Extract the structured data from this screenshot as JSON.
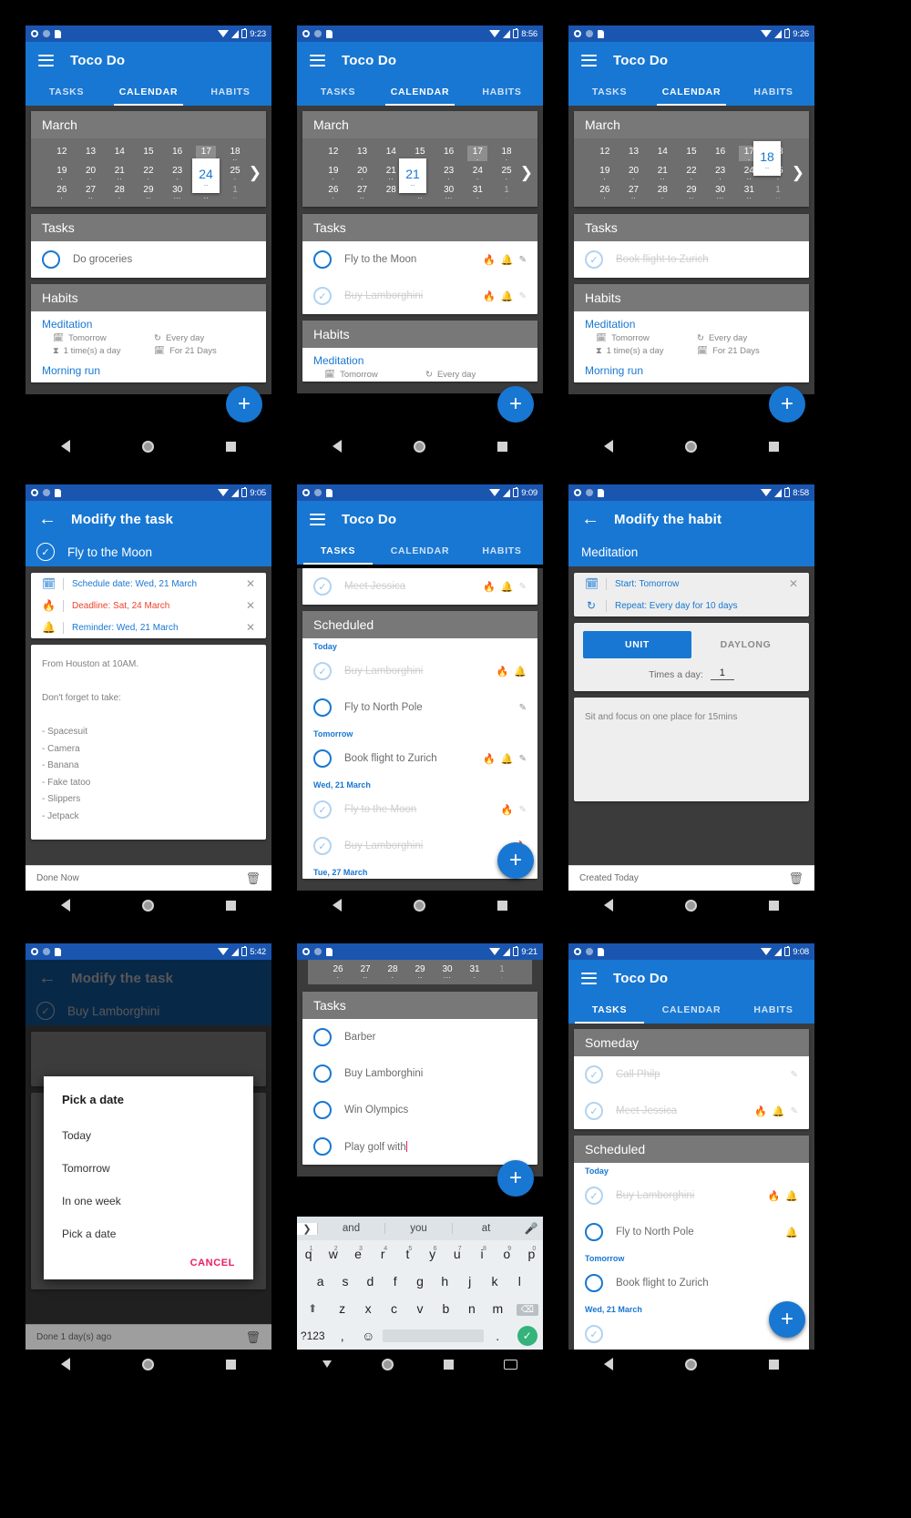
{
  "app": {
    "name": "Toco Do"
  },
  "tabs": {
    "tasks": "TASKS",
    "calendar": "CALENDAR",
    "habits": "HABITS"
  },
  "sections": {
    "tasks": "Tasks",
    "habits": "Habits",
    "scheduled": "Scheduled",
    "someday": "Someday"
  },
  "screens": [
    {
      "id": "calendar-24",
      "time": "9:23",
      "title": "Toco Do",
      "active_tab": "CALENDAR",
      "month": "March",
      "calendar": {
        "rows": [
          [
            {
              "d": "12"
            },
            {
              "d": "13"
            },
            {
              "d": "14"
            },
            {
              "d": "15"
            },
            {
              "d": "16"
            },
            {
              "d": "17",
              "today": true
            },
            {
              "d": "18",
              "dots": ".."
            }
          ],
          [
            {
              "d": "19",
              "dots": "."
            },
            {
              "d": "20",
              "dots": "."
            },
            {
              "d": "21",
              "dots": ".."
            },
            {
              "d": "22",
              "dots": "."
            },
            {
              "d": "23",
              "dots": "."
            },
            {
              "d": "24",
              "dots": ".."
            },
            {
              "d": "25",
              "dots": "."
            }
          ],
          [
            {
              "d": "26",
              "dots": "."
            },
            {
              "d": "27",
              "dots": ".."
            },
            {
              "d": "28",
              "dots": "."
            },
            {
              "d": "29",
              "dots": ".."
            },
            {
              "d": "30",
              "dots": "..."
            },
            {
              "d": "31",
              "dots": ".."
            },
            {
              "d": "1",
              "dots": "..",
              "muted": true
            }
          ]
        ],
        "selected": {
          "day": "24",
          "dots": ".."
        }
      },
      "tasks": [
        {
          "label": "Do groceries",
          "done": false,
          "icons": []
        }
      ],
      "habit": {
        "name": "Meditation",
        "when": "Tomorrow",
        "repeat": "Every day",
        "times": "1 time(s) a day",
        "duration": "For 21 Days",
        "next": "Morning run"
      }
    },
    {
      "id": "calendar-21",
      "time": "8:56",
      "title": "Toco Do",
      "active_tab": "CALENDAR",
      "month": "March",
      "calendar": {
        "rows": [
          [
            {
              "d": "12"
            },
            {
              "d": "13"
            },
            {
              "d": "14"
            },
            {
              "d": "15"
            },
            {
              "d": "16"
            },
            {
              "d": "17",
              "today": true,
              "dots": "."
            },
            {
              "d": "18",
              "dots": "."
            }
          ],
          [
            {
              "d": "19",
              "dots": "."
            },
            {
              "d": "20",
              "dots": "."
            },
            {
              "d": "21",
              "dots": ".."
            },
            {
              "d": "22",
              "dots": "."
            },
            {
              "d": "23",
              "dots": "."
            },
            {
              "d": "24",
              "dots": "."
            },
            {
              "d": "25",
              "dots": "."
            }
          ],
          [
            {
              "d": "26",
              "dots": "."
            },
            {
              "d": "27",
              "dots": ".."
            },
            {
              "d": "28",
              "dots": ""
            },
            {
              "d": "29",
              "dots": ".."
            },
            {
              "d": "30",
              "dots": "..."
            },
            {
              "d": "31",
              "dots": "."
            },
            {
              "d": "1",
              "dots": ".",
              "muted": true
            }
          ]
        ],
        "selected": {
          "day": "21",
          "dots": ".."
        }
      },
      "tasks": [
        {
          "label": "Fly to the Moon",
          "done": false,
          "icons": [
            "fire",
            "bell",
            "pen"
          ]
        },
        {
          "label": "Buy Lamborghini",
          "done": true,
          "icons": [
            "fire",
            "bell",
            "pen"
          ]
        }
      ],
      "habit": {
        "name": "Meditation",
        "when": "Tomorrow",
        "repeat": "Every day"
      }
    },
    {
      "id": "calendar-18",
      "time": "9:26",
      "title": "Toco Do",
      "active_tab": "CALENDAR",
      "month": "March",
      "calendar": {
        "rows": [
          [
            {
              "d": "12"
            },
            {
              "d": "13"
            },
            {
              "d": "14"
            },
            {
              "d": "15"
            },
            {
              "d": "16"
            },
            {
              "d": "17",
              "today": true,
              "dots": "."
            },
            {
              "d": "18"
            }
          ],
          [
            {
              "d": "19",
              "dots": "."
            },
            {
              "d": "20",
              "dots": "."
            },
            {
              "d": "21",
              "dots": ".."
            },
            {
              "d": "22",
              "dots": "."
            },
            {
              "d": "23",
              "dots": "."
            },
            {
              "d": "24",
              "dots": ".."
            },
            {
              "d": "25",
              "dots": "."
            }
          ],
          [
            {
              "d": "26",
              "dots": "."
            },
            {
              "d": "27",
              "dots": ".."
            },
            {
              "d": "28",
              "dots": "."
            },
            {
              "d": "29",
              "dots": ".."
            },
            {
              "d": "30",
              "dots": "..."
            },
            {
              "d": "31",
              "dots": ".."
            },
            {
              "d": "1",
              "dots": "..",
              "muted": true
            }
          ]
        ],
        "selected": {
          "day": "18",
          "dots": ".."
        }
      },
      "tasks": [
        {
          "label": "Book flight to Zurich",
          "done": true,
          "icons": []
        }
      ],
      "habit": {
        "name": "Meditation",
        "when": "Tomorrow",
        "repeat": "Every day",
        "times": "1 time(s) a day",
        "duration": "For 21 Days",
        "next": "Morning run"
      }
    },
    {
      "id": "modify-task-moon",
      "time": "9:05",
      "title": "Modify the task",
      "task_name": "Fly to the Moon",
      "meta": [
        {
          "icon": "calendar-icon",
          "text": "Schedule date: Wed, 21 March",
          "color": "blue"
        },
        {
          "icon": "fire-icon",
          "text": "Deadline: Sat, 24 March",
          "color": "red"
        },
        {
          "icon": "bell-icon",
          "text": "Reminder: Wed, 21 March",
          "color": "blue"
        }
      ],
      "notes": "From Houston at 10AM.\n\nDon't forget to take:\n\n- Spacesuit\n- Camera\n- Banana\n- Fake tatoo\n- Slippers\n- Jetpack",
      "footer": "Done Now"
    },
    {
      "id": "tasks-scheduled",
      "time": "9:09",
      "title": "Toco Do",
      "active_tab": "TASKS",
      "top_task": {
        "label": "Meet Jessica",
        "done": true,
        "icons": [
          "fire",
          "bell",
          "pen"
        ]
      },
      "groups": [
        {
          "header": "Today",
          "items": [
            {
              "label": "Buy Lamborghini",
              "done": true,
              "icons": [
                "fire",
                "bell"
              ]
            },
            {
              "label": "Fly to North Pole",
              "done": false,
              "icons": [
                "pen"
              ]
            }
          ]
        },
        {
          "header": "Tomorrow",
          "items": [
            {
              "label": "Book flight to Zurich",
              "done": false,
              "icons": [
                "fire",
                "bell",
                "pen"
              ]
            }
          ]
        },
        {
          "header": "Wed, 21 March",
          "items": [
            {
              "label": "Fly to the Moon",
              "done": true,
              "icons": [
                "fire",
                "pen"
              ]
            },
            {
              "label": "Buy Lamborghini",
              "done": true,
              "icons": [
                "fire"
              ]
            }
          ]
        },
        {
          "header": "Tue, 27 March",
          "items": []
        }
      ]
    },
    {
      "id": "modify-habit",
      "time": "8:58",
      "title": "Modify the habit",
      "habit_name": "Meditation",
      "meta": [
        {
          "icon": "calendar-icon",
          "text": "Start: Tomorrow",
          "color": "blue"
        },
        {
          "icon": "repeat-icon",
          "text": "Repeat: Every day for 10 days",
          "color": "blue"
        }
      ],
      "segments": {
        "unit": "UNIT",
        "daylong": "DAYLONG",
        "active": "UNIT"
      },
      "times_label": "Times a day:",
      "times_value": "1",
      "notes": "Sit and focus on one place for 15mins",
      "footer": "Created Today"
    },
    {
      "id": "modify-task-lambo",
      "time": "5:42",
      "title": "Modify the task",
      "task_name": "Buy Lamborghini",
      "dialog": {
        "title": "Pick a date",
        "options": [
          "Today",
          "Tomorrow",
          "In one week",
          "Pick a date"
        ],
        "cancel": "CANCEL"
      },
      "footer": "Done 1 day(s) ago"
    },
    {
      "id": "tasks-keyboard",
      "time": "9:21",
      "calendar_strip": [
        {
          "d": "26",
          "dots": "."
        },
        {
          "d": "27",
          "dots": ".."
        },
        {
          "d": "28",
          "dots": "."
        },
        {
          "d": "29",
          "dots": ".."
        },
        {
          "d": "30",
          "dots": "..."
        },
        {
          "d": "31",
          "dots": "."
        },
        {
          "d": "1",
          "dots": ".",
          "muted": true
        }
      ],
      "tasks": [
        {
          "label": "Barber",
          "done": false
        },
        {
          "label": "Buy Lamborghini",
          "done": false
        },
        {
          "label": "Win Olympics",
          "done": false
        },
        {
          "label": "Play golf with",
          "done": false,
          "editing": true
        }
      ],
      "keyboard": {
        "suggestions": [
          "and",
          "you",
          "at"
        ],
        "row1": [
          {
            "k": "q",
            "n": "1"
          },
          {
            "k": "w",
            "n": "2"
          },
          {
            "k": "e",
            "n": "3"
          },
          {
            "k": "r",
            "n": "4"
          },
          {
            "k": "t",
            "n": "5"
          },
          {
            "k": "y",
            "n": "6"
          },
          {
            "k": "u",
            "n": "7"
          },
          {
            "k": "i",
            "n": "8"
          },
          {
            "k": "o",
            "n": "9"
          },
          {
            "k": "p",
            "n": "0"
          }
        ],
        "row2": [
          "a",
          "s",
          "d",
          "f",
          "g",
          "h",
          "j",
          "k",
          "l"
        ],
        "row3": [
          "z",
          "x",
          "c",
          "v",
          "b",
          "n",
          "m"
        ],
        "symbols_key": "?123",
        "comma_key": ",",
        "period_key": ".",
        "emoji_key": "☺"
      }
    },
    {
      "id": "tasks-someday",
      "time": "9:08",
      "title": "Toco Do",
      "active_tab": "TASKS",
      "someday": [
        {
          "label": "Call Philp",
          "done": true,
          "icons": [
            "pen"
          ]
        },
        {
          "label": "Meet Jessica",
          "done": true,
          "icons": [
            "fire",
            "bell",
            "pen"
          ]
        }
      ],
      "groups": [
        {
          "header": "Today",
          "items": [
            {
              "label": "Buy Lamborghini",
              "done": true,
              "icons": [
                "fire",
                "bell"
              ]
            },
            {
              "label": "Fly to North Pole",
              "done": false,
              "icons": [
                "bell"
              ]
            }
          ]
        },
        {
          "header": "Tomorrow",
          "items": [
            {
              "label": "Book flight to Zurich",
              "done": false,
              "icons": []
            }
          ]
        },
        {
          "header": "Wed, 21 March",
          "items": []
        }
      ]
    }
  ],
  "colors": {
    "primary": "#1877d2",
    "status_bar": "#1a56b0",
    "section_header": "#787878",
    "page_bg": "#3b3b3b",
    "accent_red": "#f0412b",
    "cancel_pink": "#e91e63"
  },
  "icons": {
    "menu": "hamburger-icon",
    "back": "back-arrow-icon",
    "fab": "+",
    "trash": "🗑",
    "chevron_right": "❯",
    "mic": "🎤",
    "shift": "⬆",
    "backspace": "⌫",
    "check": "✓"
  }
}
